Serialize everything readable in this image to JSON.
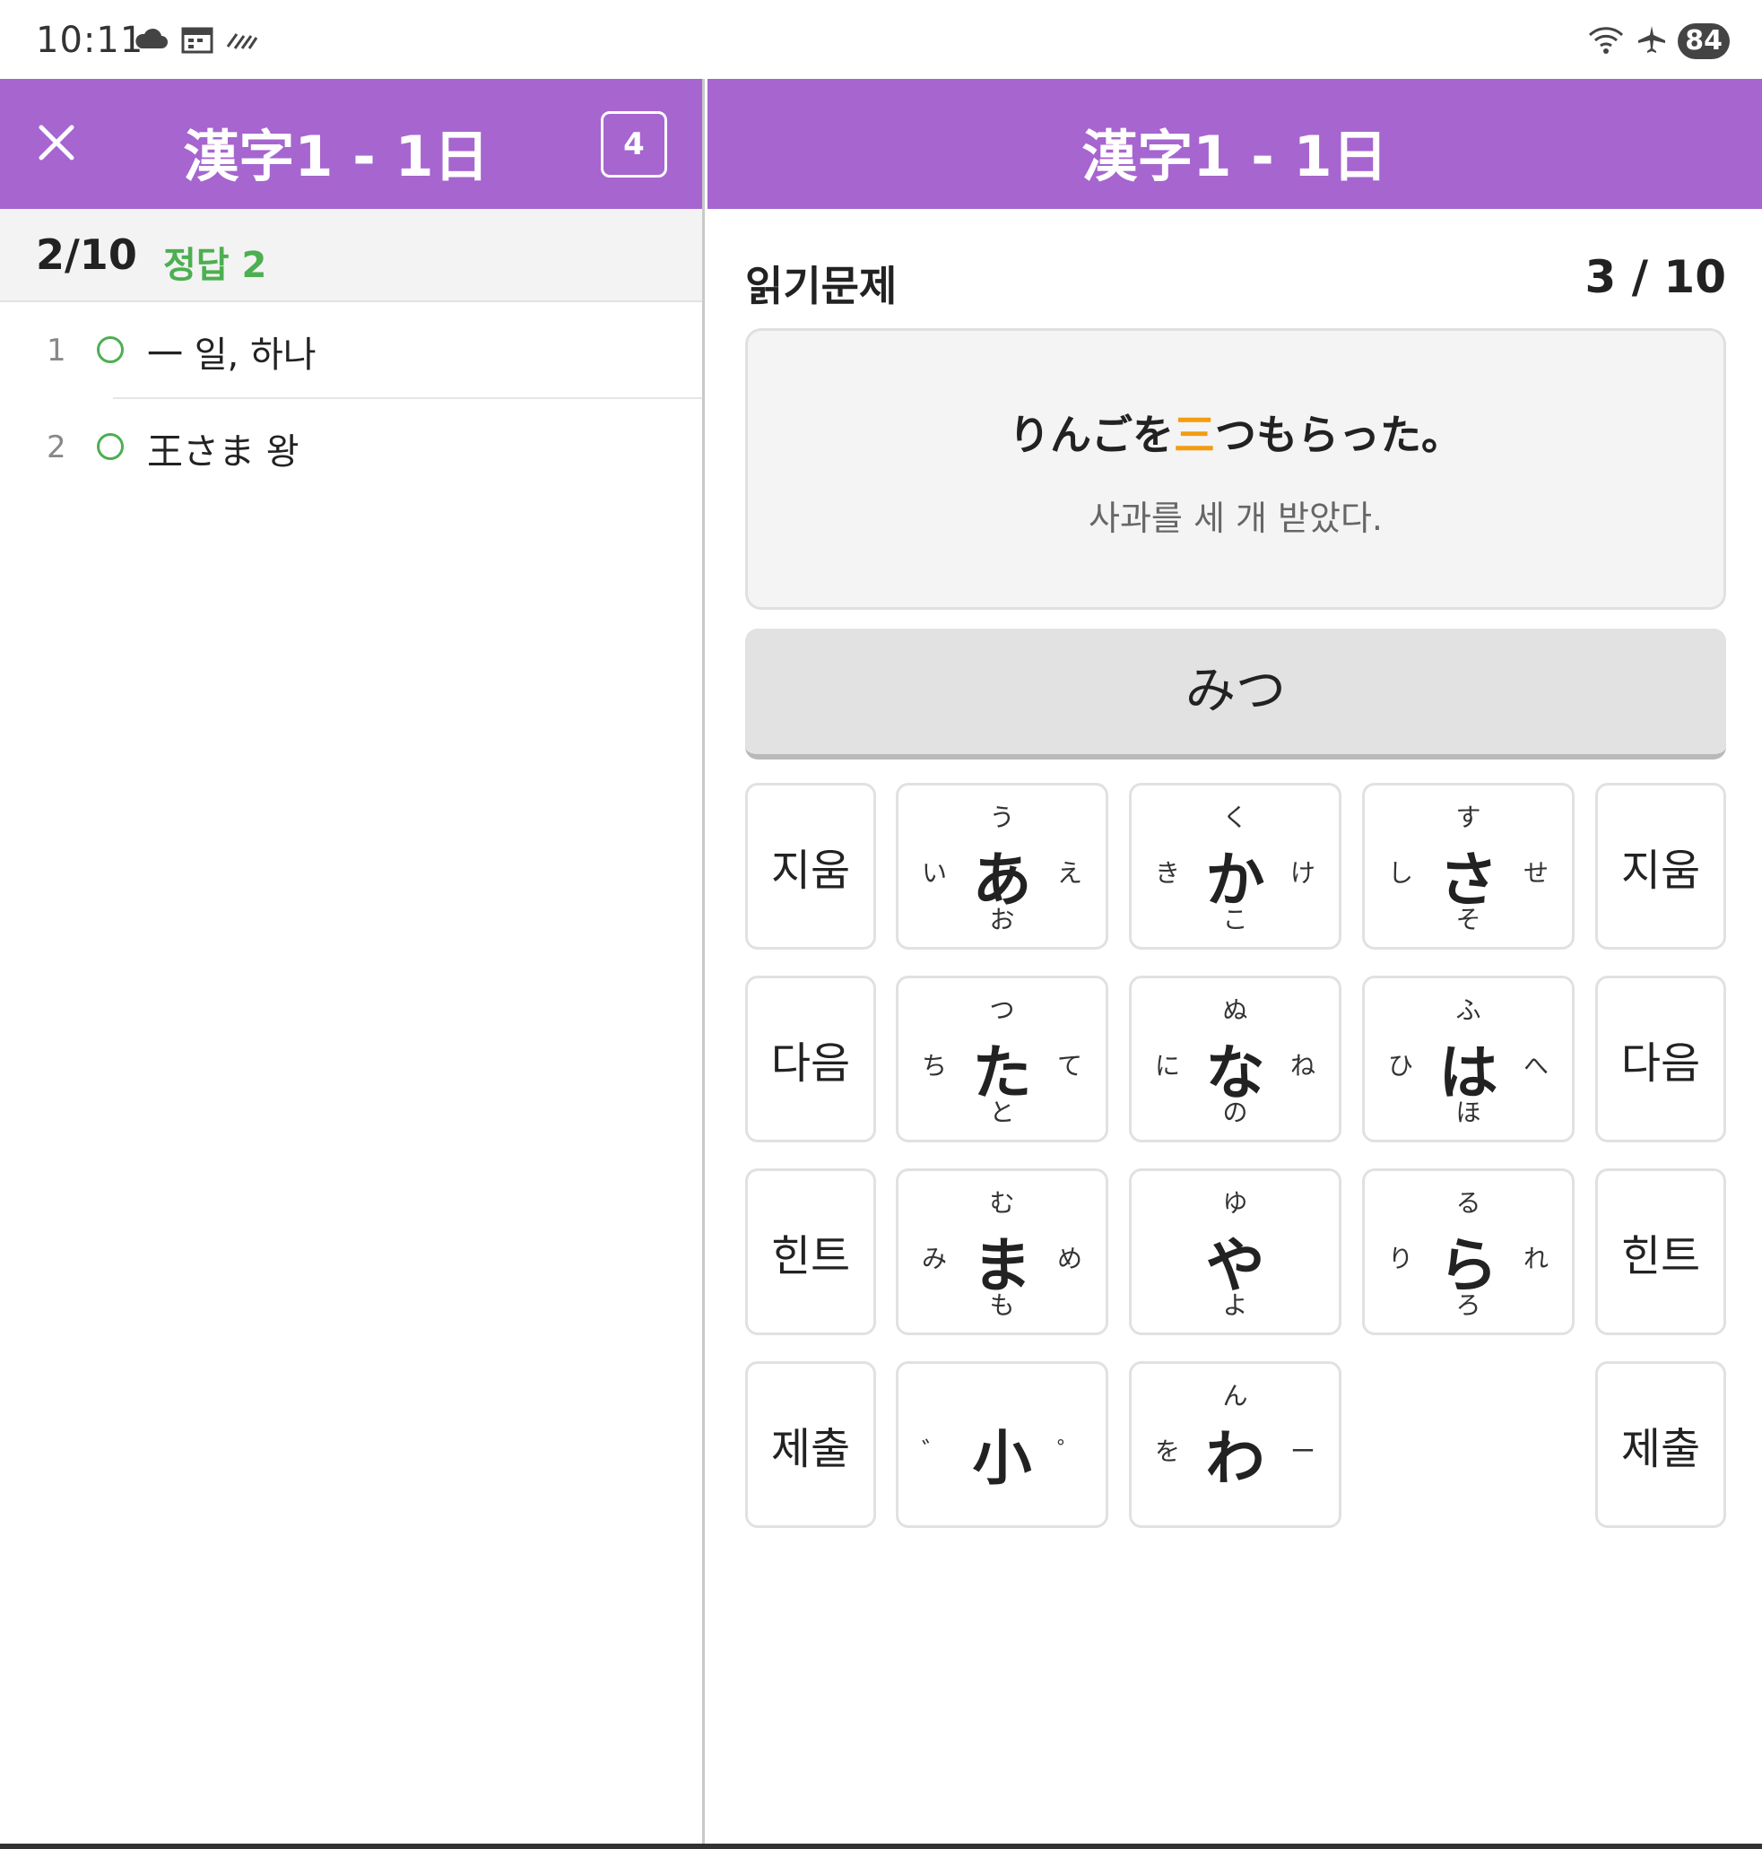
{
  "status_bar": {
    "time": "10:11",
    "left_icons": [
      "cloud-icon",
      "calendar-icon",
      "signal-lines-icon"
    ],
    "right_icons": [
      "wifi-icon",
      "airplane-icon"
    ],
    "battery": "84"
  },
  "colors": {
    "header_purple": "#a665cf",
    "correct_green": "#4caf50",
    "highlight_orange": "#f39c12"
  },
  "left_panel": {
    "title": "漢字1 - 1日",
    "count_badge": "4",
    "progress": "2/10",
    "correct_label": "정답 2",
    "items": [
      {
        "num": "1",
        "text": "一  일, 하나"
      },
      {
        "num": "2",
        "text": "王さま 왕"
      }
    ]
  },
  "right_panel": {
    "title": "漢字1 - 1日",
    "question_type": "읽기문제",
    "question_number": "3 / 10",
    "sentence_before": "りんごを",
    "sentence_highlight": "三",
    "sentence_after": "つもらった。",
    "translation": "사과를 세 개 받았다.",
    "answer": "みつ"
  },
  "keypad": {
    "side_left": [
      "지움",
      "다음",
      "힌트",
      "제출"
    ],
    "side_right": [
      "지움",
      "다음",
      "힌트",
      "제출"
    ],
    "keys": [
      {
        "main": "あ",
        "top": "う",
        "left": "い",
        "right": "え",
        "bottom": "お"
      },
      {
        "main": "か",
        "top": "く",
        "left": "き",
        "right": "け",
        "bottom": "こ"
      },
      {
        "main": "さ",
        "top": "す",
        "left": "し",
        "right": "せ",
        "bottom": "そ"
      },
      {
        "main": "た",
        "top": "つ",
        "left": "ち",
        "right": "て",
        "bottom": "と"
      },
      {
        "main": "な",
        "top": "ぬ",
        "left": "に",
        "right": "ね",
        "bottom": "の"
      },
      {
        "main": "は",
        "top": "ふ",
        "left": "ひ",
        "right": "へ",
        "bottom": "ほ"
      },
      {
        "main": "ま",
        "top": "む",
        "left": "み",
        "right": "め",
        "bottom": "も"
      },
      {
        "main": "や",
        "top": "ゆ",
        "left": "",
        "right": "",
        "bottom": "よ"
      },
      {
        "main": "ら",
        "top": "る",
        "left": "り",
        "right": "れ",
        "bottom": "ろ"
      },
      {
        "main": "小",
        "top": "",
        "left": "゛",
        "right": "゜",
        "bottom": ""
      },
      {
        "main": "わ",
        "top": "ん",
        "left": "を",
        "right": "ー",
        "bottom": ""
      }
    ]
  }
}
